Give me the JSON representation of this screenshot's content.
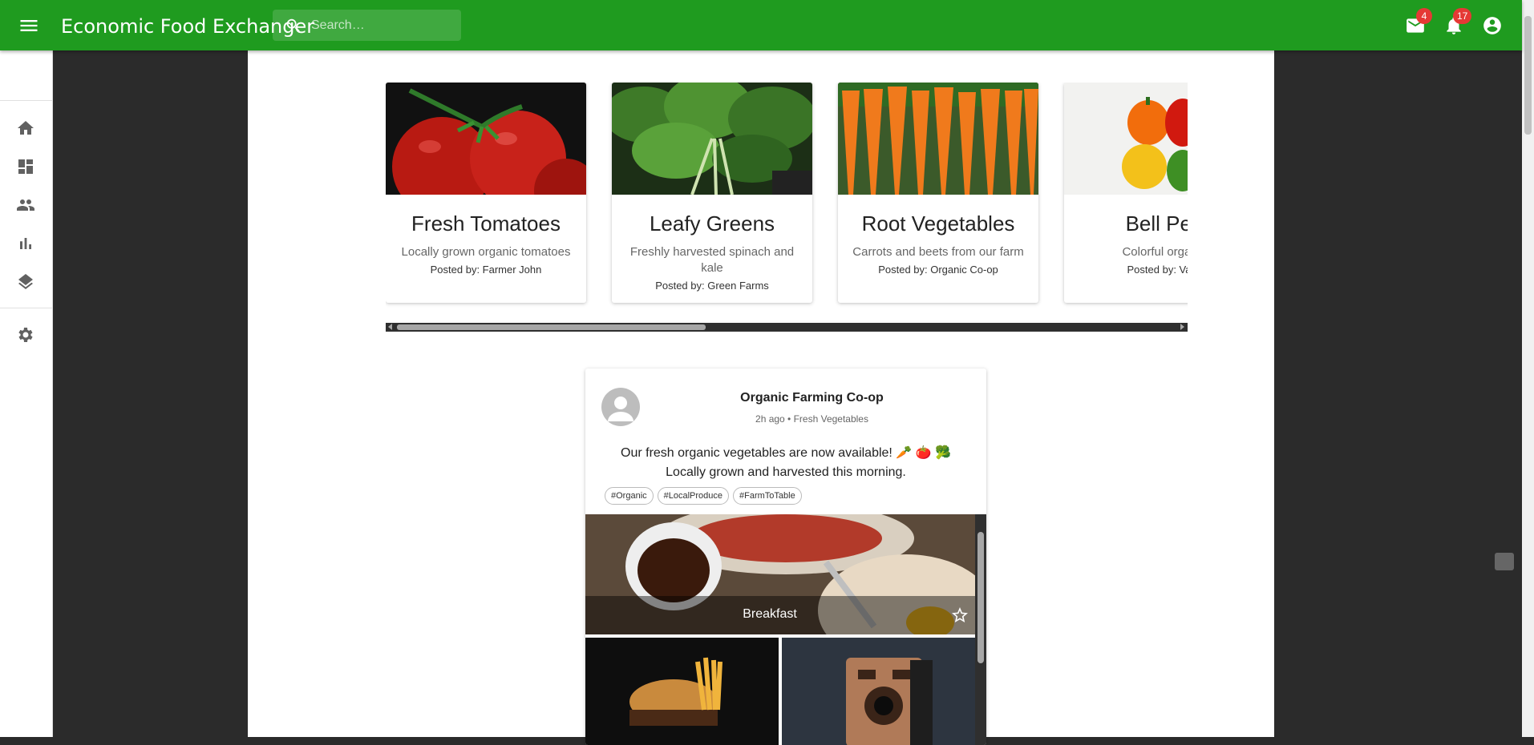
{
  "app": {
    "title": "Economic Food Exchanger"
  },
  "search": {
    "placeholder": "Search…"
  },
  "header": {
    "mail_icon": "mail-icon",
    "mail_count": "4",
    "notifications_icon": "bell-icon",
    "notifications_count": "17",
    "account_icon": "account-circle-icon"
  },
  "sidebar": {
    "items": [
      {
        "icon": "home-icon"
      },
      {
        "icon": "dashboard-icon"
      },
      {
        "icon": "people-icon"
      },
      {
        "icon": "bar-chart-icon"
      },
      {
        "icon": "layers-icon"
      },
      {
        "icon": "settings-icon"
      }
    ]
  },
  "products": [
    {
      "title": "Fresh Tomatoes",
      "description": "Locally grown organic tomatoes",
      "posted_by": "Posted by: Farmer John"
    },
    {
      "title": "Leafy Greens",
      "description": "Freshly harvested spinach and kale",
      "posted_by": "Posted by: Green Farms"
    },
    {
      "title": "Root Vegetables",
      "description": "Carrots and beets from our farm",
      "posted_by": "Posted by: Organic Co-op"
    },
    {
      "title": "Bell Pep",
      "description": "Colorful organic",
      "posted_by": "Posted by: Valle"
    }
  ],
  "post": {
    "author": "Organic Farming Co-op",
    "meta": "2h ago • Fresh Vegetables",
    "text_line1": "Our fresh organic vegetables are now available! 🥕 🍅 🥦",
    "text_line2": "Locally grown and harvested this morning.",
    "tags": [
      "#Organic",
      "#LocalProduce",
      "#FarmToTable"
    ],
    "gallery_caption": "Breakfast"
  },
  "colors": {
    "app_bar": "#1f9b1f",
    "badge": "#e53935"
  }
}
